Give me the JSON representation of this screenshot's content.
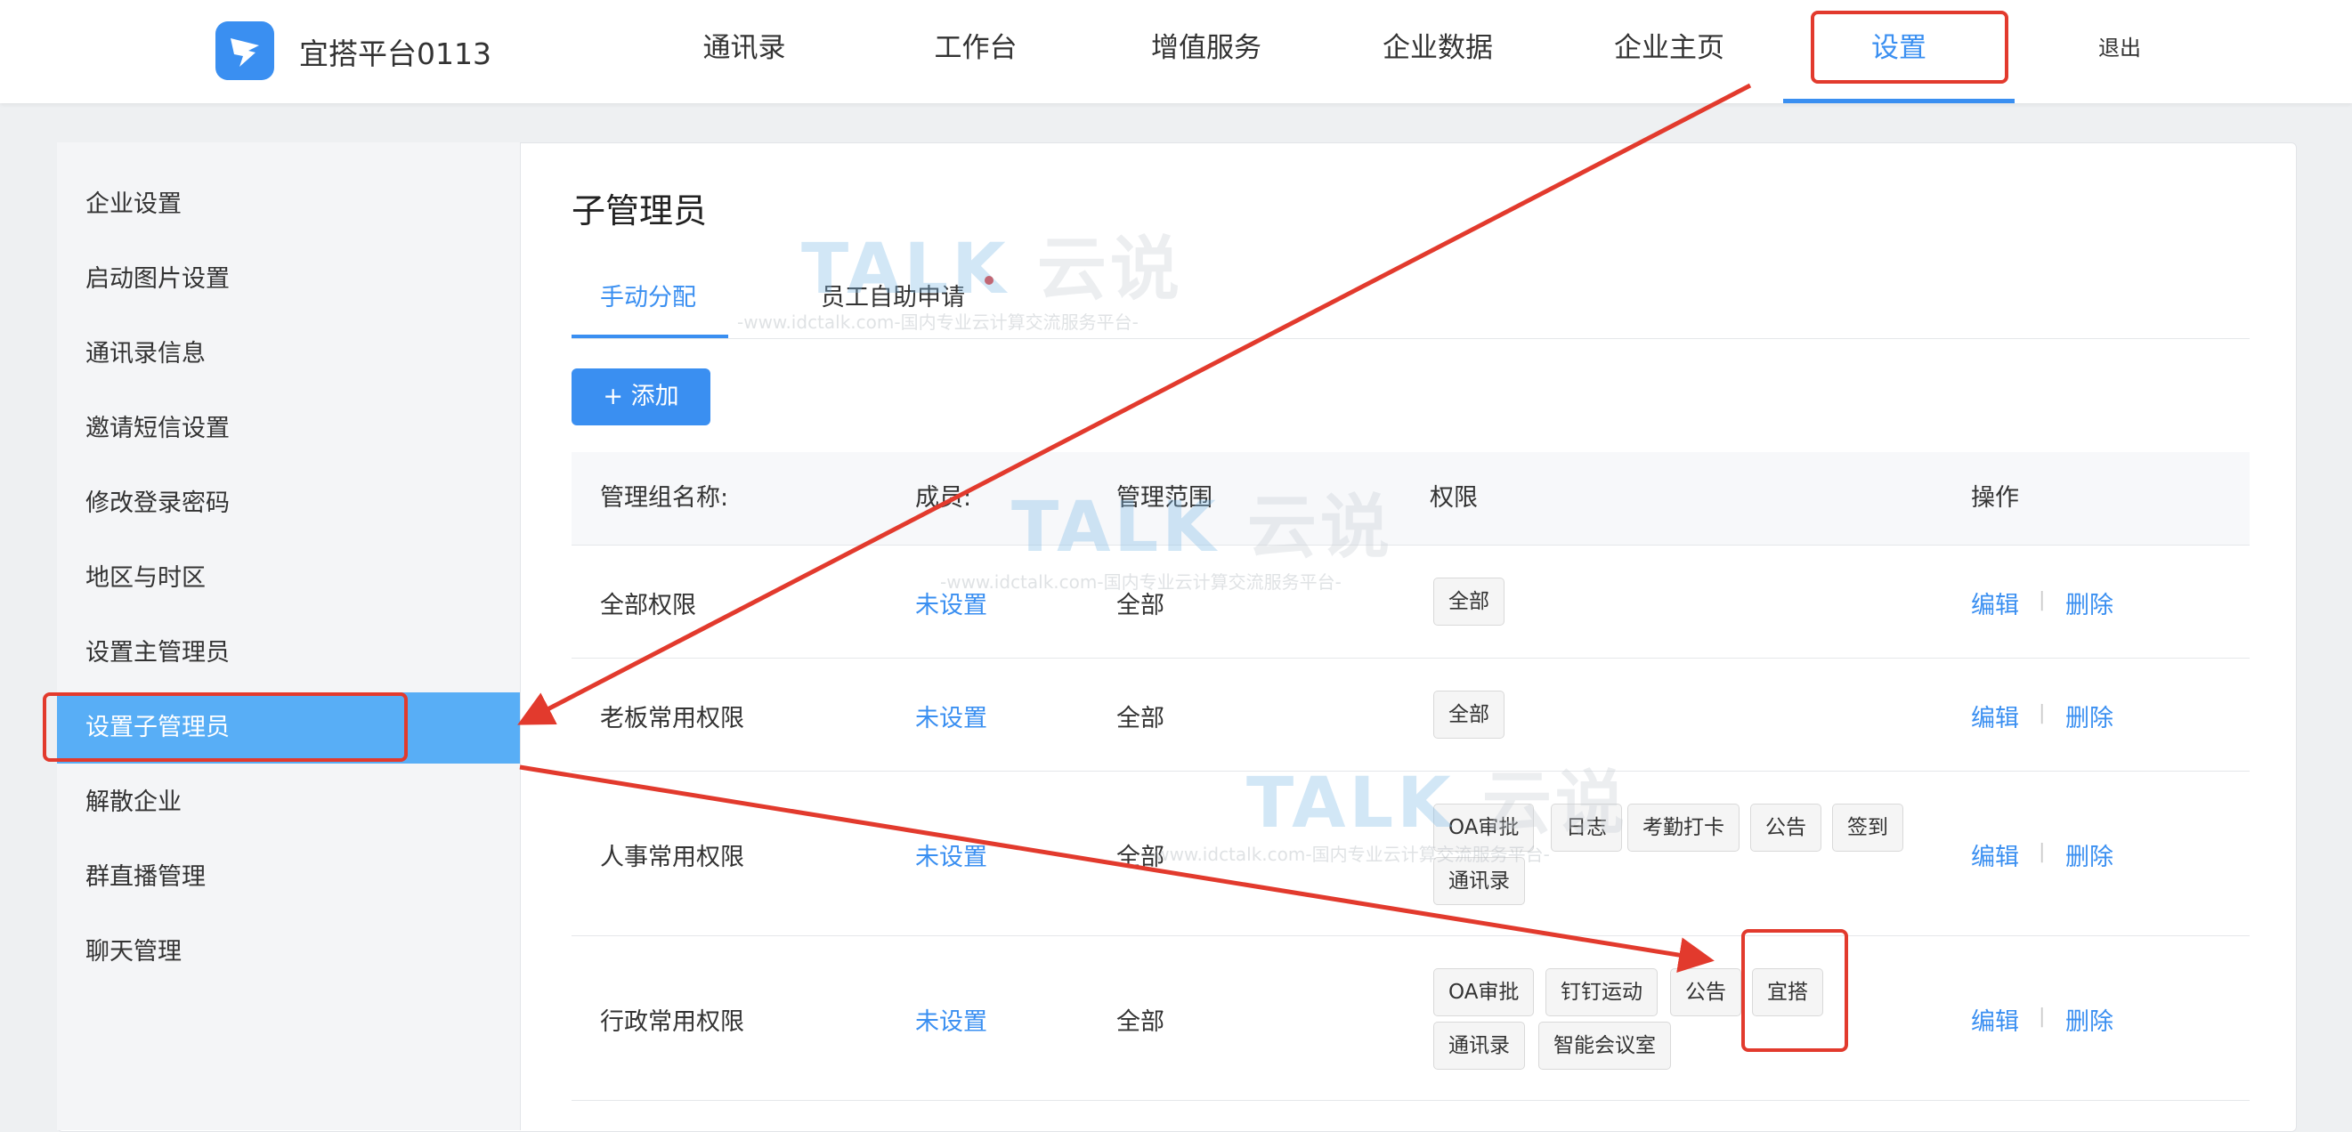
{
  "header": {
    "brand": "宜搭平台0113",
    "nav": [
      "通讯录",
      "工作台",
      "增值服务",
      "企业数据",
      "企业主页",
      "设置"
    ],
    "active_nav": "设置",
    "logout": "退出"
  },
  "sidebar": {
    "items": [
      "企业设置",
      "启动图片设置",
      "通讯录信息",
      "邀请短信设置",
      "修改登录密码",
      "地区与时区",
      "设置主管理员",
      "设置子管理员",
      "解散企业",
      "群直播管理",
      "聊天管理"
    ],
    "active": "设置子管理员"
  },
  "main": {
    "title": "子管理员",
    "tabs": [
      "手动分配",
      "员工自助申请"
    ],
    "add_button": "+ 添加",
    "columns": [
      "管理组名称:",
      "成员:",
      "管理范围",
      "权限",
      "操作"
    ],
    "rows": [
      {
        "name": "全部权限",
        "member": "未设置",
        "scope": "全部",
        "perms": [
          "全部"
        ]
      },
      {
        "name": "老板常用权限",
        "member": "未设置",
        "scope": "全部",
        "perms": [
          "全部"
        ]
      },
      {
        "name": "人事常用权限",
        "member": "未设置",
        "scope": "全部",
        "perms": [
          "OA审批",
          "日志",
          "考勤打卡",
          "公告",
          "签到",
          "通讯录"
        ]
      },
      {
        "name": "行政常用权限",
        "member": "未设置",
        "scope": "全部",
        "perms": [
          "OA审批",
          "钉钉运动",
          "公告",
          "宜搭",
          "通讯录",
          "智能会议室"
        ]
      }
    ],
    "actions": {
      "edit": "编辑",
      "delete": "删除",
      "separator": "|"
    }
  },
  "watermark": {
    "logo_text": "TALK",
    "logo_cn": "云说",
    "url_text": "-www.idctalk.com-国内专业云计算交流服务平台-"
  },
  "colors": {
    "accent": "#3a8ff1",
    "sidebar_active": "#58aef6",
    "annotation_red": "#e23a2d"
  }
}
